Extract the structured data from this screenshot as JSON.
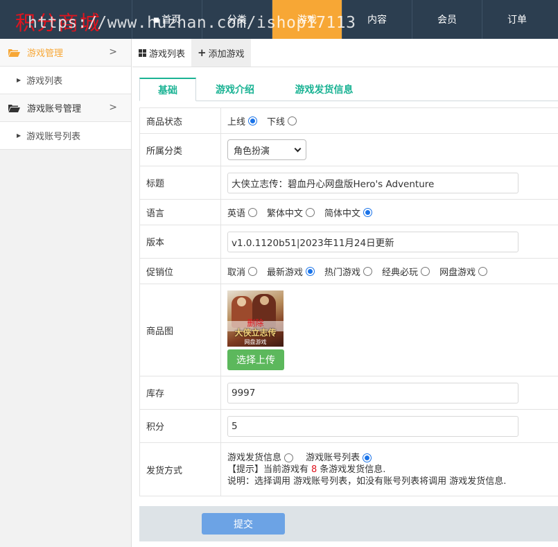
{
  "brand": {
    "name": "积分商城",
    "watermark": "https://www.huzhan.com/ishop17113"
  },
  "nav": {
    "items": [
      {
        "label": "首页",
        "icon": "home-icon"
      },
      {
        "label": "分类"
      },
      {
        "label": "游戏",
        "active": true
      },
      {
        "label": "内容"
      },
      {
        "label": "会员"
      },
      {
        "label": "订单"
      }
    ]
  },
  "sidebar": {
    "groups": [
      {
        "label": "游戏管理",
        "icon": "folder-open-icon",
        "active": true,
        "sub": "游戏列表"
      },
      {
        "label": "游戏账号管理",
        "icon": "folder-open-icon",
        "sub": "游戏账号列表"
      }
    ]
  },
  "tabs": {
    "list": "游戏列表",
    "add": "添加游戏"
  },
  "form_tabs": {
    "basic": "基础",
    "intro": "游戏介绍",
    "shipping": "游戏发货信息"
  },
  "form": {
    "status": {
      "label": "商品状态",
      "opt_on": "上线",
      "opt_off": "下线",
      "selected": "上线"
    },
    "category": {
      "label": "所属分类",
      "value": "角色扮演"
    },
    "title": {
      "label": "标题",
      "value": "大侠立志传：碧血丹心网盘版Hero's Adventure"
    },
    "language": {
      "label": "语言",
      "opt1": "英语",
      "opt2": "繁体中文",
      "opt3": "简体中文",
      "selected": "简体中文"
    },
    "version": {
      "label": "版本",
      "value": "v1.0.1120b51|2023年11月24日更新"
    },
    "promo": {
      "label": "促销位",
      "opt1": "取消",
      "opt2": "最新游戏",
      "opt3": "热门游戏",
      "opt4": "经典必玩",
      "opt5": "网盘游戏",
      "selected": "最新游戏"
    },
    "image": {
      "label": "商品图",
      "delete": "删除",
      "game_title": "大侠立志传",
      "game_sub": "网盘游戏",
      "upload": "选择上传"
    },
    "stock": {
      "label": "库存",
      "value": "9997"
    },
    "points": {
      "label": "积分",
      "value": "5"
    },
    "shipping": {
      "label": "发货方式",
      "opt1": "游戏发货信息",
      "opt2": "游戏账号列表",
      "selected": "游戏账号列表",
      "hint_prefix": "【提示】当前游戏有",
      "hint_count": "8",
      "hint_suffix": "条游戏发货信息.",
      "note": "说明：选择调用 游戏账号列表，如没有账号列表将调用 游戏发货信息."
    }
  },
  "submit": {
    "label": "提交"
  },
  "colors": {
    "topbar": "#2c3e50",
    "active_nav": "#f7a735",
    "tab_accent": "#1bb394",
    "upload": "#5cb85c",
    "submit": "#6ca3e5"
  }
}
